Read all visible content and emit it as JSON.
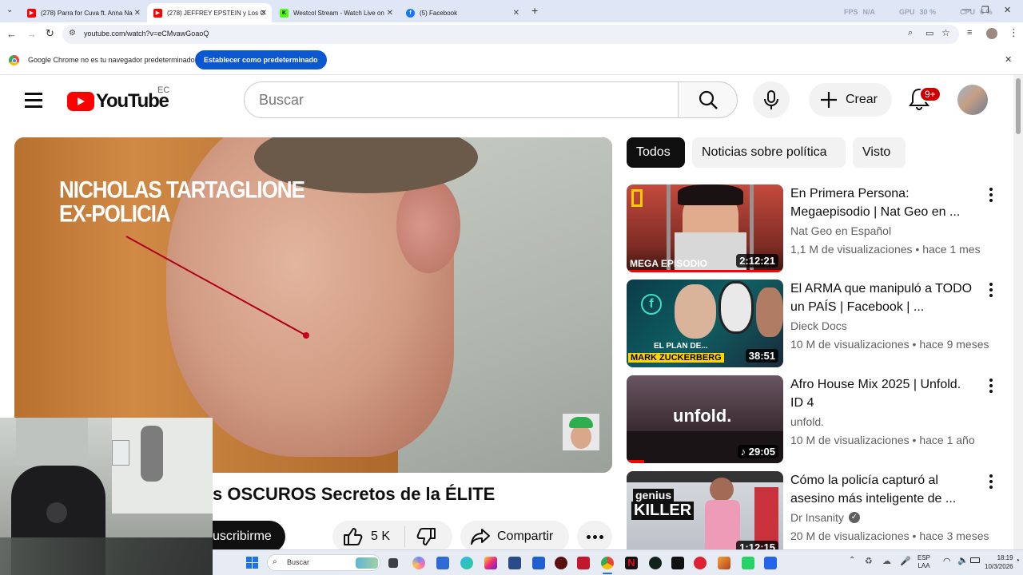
{
  "browser": {
    "tabs": [
      {
        "label": "(278) Parra for Cuva ft. Anna Na",
        "favicon": "youtube-favicon",
        "color": "#ff0000"
      },
      {
        "label": "(278) JEFFREY EPSTEIN y Los O",
        "favicon": "youtube-favicon",
        "color": "#ff0000"
      },
      {
        "label": "Westcol Stream - Watch Live on",
        "favicon": "kick-favicon",
        "color": "#53fc18"
      },
      {
        "label": "(5) Facebook",
        "favicon": "facebook-favicon",
        "color": "#1877f2"
      }
    ],
    "new_tab": "+",
    "perf": {
      "fps_label": "FPS",
      "fps": "N/A",
      "gpu_label": "GPU",
      "gpu": "30 %",
      "cpu_label": "CPU",
      "cpu": "6 %"
    },
    "url": "youtube.com/watch?v=eCMvawGoaoQ",
    "infobar": {
      "message": "Google Chrome no es tu navegador predeterminado",
      "button": "Establecer como predeterminado"
    }
  },
  "youtube": {
    "logo_text": "YouTube",
    "country": "EC",
    "search_placeholder": "Buscar",
    "create_label": "Crear",
    "notification_badge": "9+"
  },
  "video": {
    "overlay_name": "NICHOLAS TARTAGLIONE",
    "overlay_role": "EX-POLICIA",
    "title_visible": "s OSCUROS Secretos de la ÉLITE",
    "subscribe_visible": "uscribirme",
    "likes": "5 K",
    "share_label": "Compartir"
  },
  "chips": [
    {
      "label": "Todos",
      "active": true
    },
    {
      "label": "Noticias sobre política",
      "active": false
    },
    {
      "label": "Visto",
      "active": false
    }
  ],
  "recommendations": [
    {
      "title": "En Primera Persona: Megaepisodio | Nat Geo en ...",
      "channel": "Nat Geo en Español",
      "views": "1,1 M de visualizaciones",
      "age": "hace 1 mes",
      "duration": "2:12:21",
      "thumb_text": "MEGA EPISODIO",
      "progress": 1.0
    },
    {
      "title": "El ARMA que manipuló a TODO un PAÍS | Facebook | ...",
      "channel": "Dieck Docs",
      "views": "10 M de visualizaciones",
      "age": "hace 9 meses",
      "duration": "38:51",
      "thumb_text_1": "EL PLAN DE...",
      "thumb_text_2": "MARK ZUCKERBERG",
      "progress": 0
    },
    {
      "title": "Afro House Mix 2025 | Unfold. ID 4",
      "channel": "unfold.",
      "views": "10 M de visualizaciones",
      "age": "hace 1 año",
      "duration": "♪ 29:05",
      "thumb_text": "unfold.",
      "progress": 0.11
    },
    {
      "title": "Cómo la policía capturó al asesino más inteligente de ...",
      "channel": "Dr Insanity",
      "verified": true,
      "views": "20 M de visualizaciones",
      "age": "hace 3 meses",
      "duration": "1:12:15",
      "thumb_text_1": "genius",
      "thumb_text_2": "KILLER",
      "progress": 0
    }
  ],
  "taskbar": {
    "search_placeholder": "Buscar",
    "lang_1": "ESP",
    "lang_2": "LAA",
    "time": "18:19",
    "date": "10/3/2026"
  }
}
